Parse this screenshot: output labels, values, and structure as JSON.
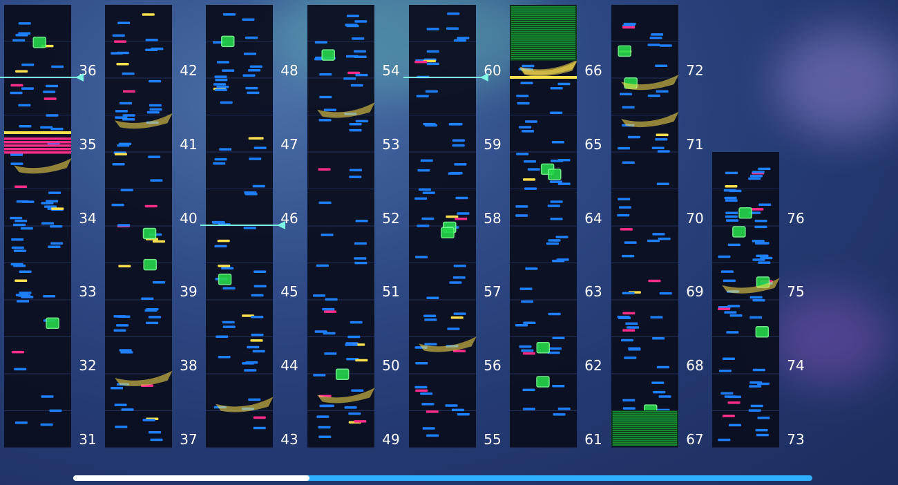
{
  "colors": {
    "lane_bg": "#0b0f1f",
    "blue_note": "#1e7fff",
    "pink_note": "#ff2d8a",
    "yellow_note": "#ffe14d",
    "green_note": "#25d64a",
    "progress_done": "#ffffff",
    "progress_remaining": "#2fb0ff"
  },
  "columns": [
    {
      "labels": [
        "31",
        "32",
        "33",
        "34",
        "35",
        "36"
      ]
    },
    {
      "labels": [
        "37",
        "38",
        "39",
        "40",
        "41",
        "42"
      ]
    },
    {
      "labels": [
        "43",
        "44",
        "45",
        "46",
        "47",
        "48"
      ]
    },
    {
      "labels": [
        "49",
        "50",
        "51",
        "52",
        "53",
        "54"
      ]
    },
    {
      "labels": [
        "55",
        "56",
        "57",
        "58",
        "59",
        "60"
      ]
    },
    {
      "labels": [
        "61",
        "62",
        "63",
        "64",
        "65",
        "66"
      ]
    },
    {
      "labels": [
        "67",
        "68",
        "69",
        "70",
        "71",
        "72"
      ]
    },
    {
      "labels": [
        "73",
        "74",
        "75",
        "76"
      ]
    }
  ],
  "progress": 0.32
}
